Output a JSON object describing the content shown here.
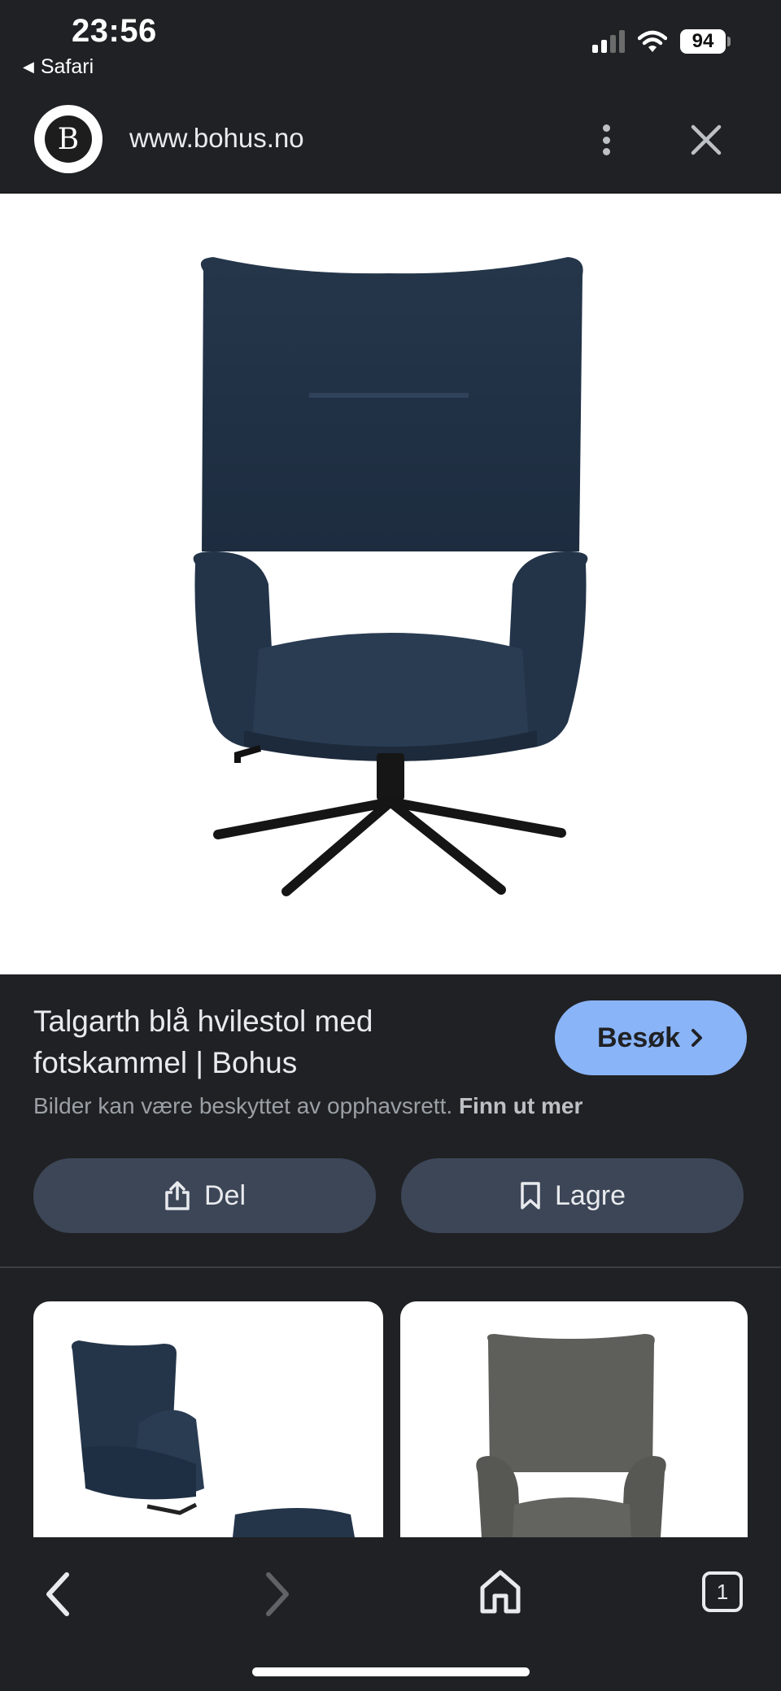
{
  "status_bar": {
    "time": "23:56",
    "back_app": "Safari",
    "battery": "94"
  },
  "browser": {
    "logo_letter": "B",
    "url": "www.bohus.no"
  },
  "result": {
    "title": "Talgarth blå hvilestol med fotskammel | Bohus",
    "visit_label": "Besøk",
    "copyright_notice": "Bilder kan være beskyttet av opphavsrett.",
    "learn_more": "Finn ut mer",
    "share_label": "Del",
    "save_label": "Lagre"
  },
  "bottom_nav": {
    "tab_count": "1"
  },
  "colors": {
    "background": "#202124",
    "accent_button": "#8ab4f8",
    "action_button": "#3c4657",
    "chair_fabric": "#24354a",
    "chair_gray": "#5e5e5b"
  },
  "icons": [
    "signal-icon",
    "wifi-icon",
    "battery-icon",
    "more-icon",
    "close-icon",
    "chevron-right-icon",
    "share-icon",
    "bookmark-icon",
    "back-icon",
    "forward-icon",
    "home-icon",
    "tabs-icon"
  ]
}
